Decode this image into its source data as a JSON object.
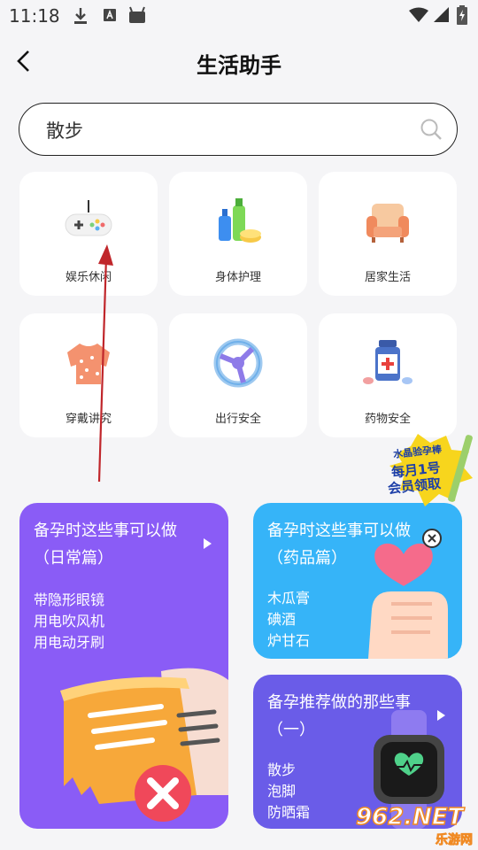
{
  "status_bar": {
    "time": "11:18"
  },
  "header": {
    "title": "生活助手"
  },
  "search": {
    "value": "散步"
  },
  "categories": [
    {
      "label": "娱乐休闲",
      "icon": "gamepad-icon"
    },
    {
      "label": "身体护理",
      "icon": "body-care-bottles-icon"
    },
    {
      "label": "居家生活",
      "icon": "armchair-icon"
    },
    {
      "label": "穿戴讲究",
      "icon": "sweater-icon"
    },
    {
      "label": "出行安全",
      "icon": "steering-wheel-icon"
    },
    {
      "label": "药物安全",
      "icon": "medicine-bottle-icon"
    }
  ],
  "banners": {
    "daily": {
      "title": "备孕时这些事可以做（日常篇）",
      "items": [
        "带隐形眼镜",
        "用电吹风机",
        "用电动牙刷"
      ],
      "color": "#8a5cf6"
    },
    "medicine": {
      "title": "备孕时这些事可以做（药品篇）",
      "items": [
        "木瓜膏",
        "碘酒",
        "炉甘石"
      ],
      "color": "#36b4f8"
    },
    "recommend": {
      "title": "备孕推荐做的那些事（一）",
      "items": [
        "散步",
        "泡脚",
        "防晒霜"
      ],
      "color": "#6a5ce8"
    }
  },
  "promo": {
    "line1": "水晶验孕棒",
    "line2": "每月1号",
    "line3": "会员领取"
  },
  "watermark": {
    "brand": "962.NET",
    "sub": "乐游网"
  }
}
